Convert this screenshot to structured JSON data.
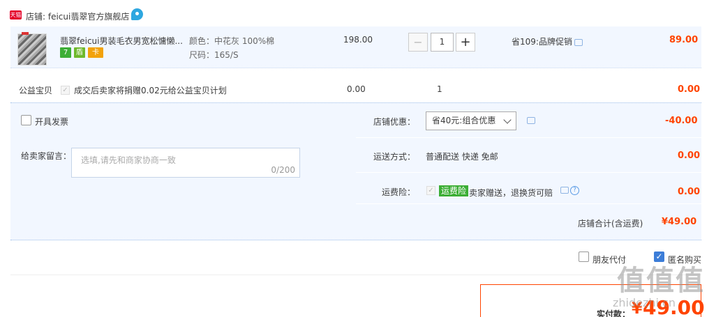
{
  "shop": {
    "platform_badge": "天猫",
    "name": "店铺: feicui翡翠官方旗舰店"
  },
  "item": {
    "title": "翡翠feicui男装毛衣男宽松慵懒...",
    "sku_color": "颜色：中花灰 100%棉",
    "sku_size": "尺码：165/S",
    "badges": [
      "7",
      "盾",
      "卡"
    ],
    "price": "198.00",
    "quantity": "1",
    "promo": "省109:品牌促销",
    "total": "89.00"
  },
  "charity": {
    "label": "公益宝贝",
    "text": "成交后卖家将捐赠0.02元给公益宝贝计划",
    "price": "0.00",
    "quantity": "1",
    "total": "0.00"
  },
  "options": {
    "invoice_label": "开具发票",
    "message_label": "给卖家留言：",
    "message_placeholder": "选填,请先和商家协商一致",
    "message_count": "0/200",
    "discount_label": "店铺优惠：",
    "discount_value": "省40元:组合优惠",
    "discount_amount": "-40.00",
    "shipping_label": "运送方式：",
    "shipping_value": "普通配送 快递 免邮",
    "shipping_amount": "0.00",
    "insurance_label": "运费险：",
    "insurance_tag": "运费险",
    "insurance_text": "卖家赠送，退换货可赔",
    "insurance_amount": "0.00",
    "subtotal_label": "店铺合计(含运费)",
    "subtotal_amount": "¥49.00"
  },
  "footer": {
    "friend_pay": "朋友代付",
    "anonymous": "匿名购买",
    "pay_label": "实付款：",
    "pay_currency": "¥",
    "pay_amount": "49.00",
    "watermark": "值值值",
    "watermark_url": "zhidezhi.cn"
  },
  "colors": {
    "accent_red": "#ff4400",
    "row_bg": "#f2f7ff",
    "check_blue": "#3c7dd8",
    "tag_green": "#3cae35"
  }
}
